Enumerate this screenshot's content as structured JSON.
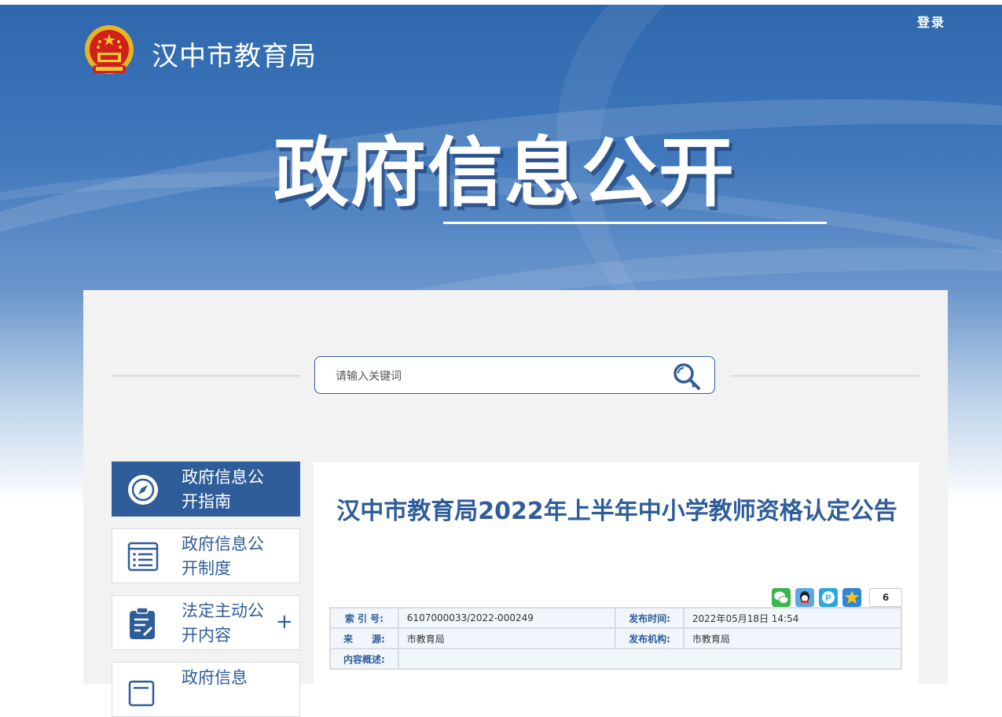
{
  "header": {
    "site_title": "汉中市教育局",
    "login": "登录",
    "hero_title": "政府信息公开"
  },
  "search": {
    "placeholder": "请输入关键词"
  },
  "sidebar": {
    "items": [
      {
        "label": "政府信息公开指南",
        "icon": "compass-icon",
        "active": true
      },
      {
        "label": "政府信息公开制度",
        "icon": "document-list-icon",
        "active": false
      },
      {
        "label": "法定主动公开内容",
        "icon": "clipboard-edit-icon",
        "active": false,
        "expand": "+"
      },
      {
        "label": "政府信息",
        "icon": "report-icon",
        "active": false
      }
    ]
  },
  "article": {
    "title": "汉中市教育局2022年上半年中小学教师资格认定公告",
    "share_count": "6",
    "meta": {
      "index_label": "索 引 号:",
      "index_value": "6107000033/2022-000249",
      "time_label": "发布时间:",
      "time_value": "2022年05月18日 14:54",
      "source_label": "来　　源:",
      "source_value": "市教育局",
      "org_label": "发布机构:",
      "org_value": "市教育局",
      "summary_label": "内容概述:",
      "summary_value": ""
    }
  },
  "colors": {
    "primary": "#2f5d99",
    "panel_bg": "#f2f2f2"
  }
}
